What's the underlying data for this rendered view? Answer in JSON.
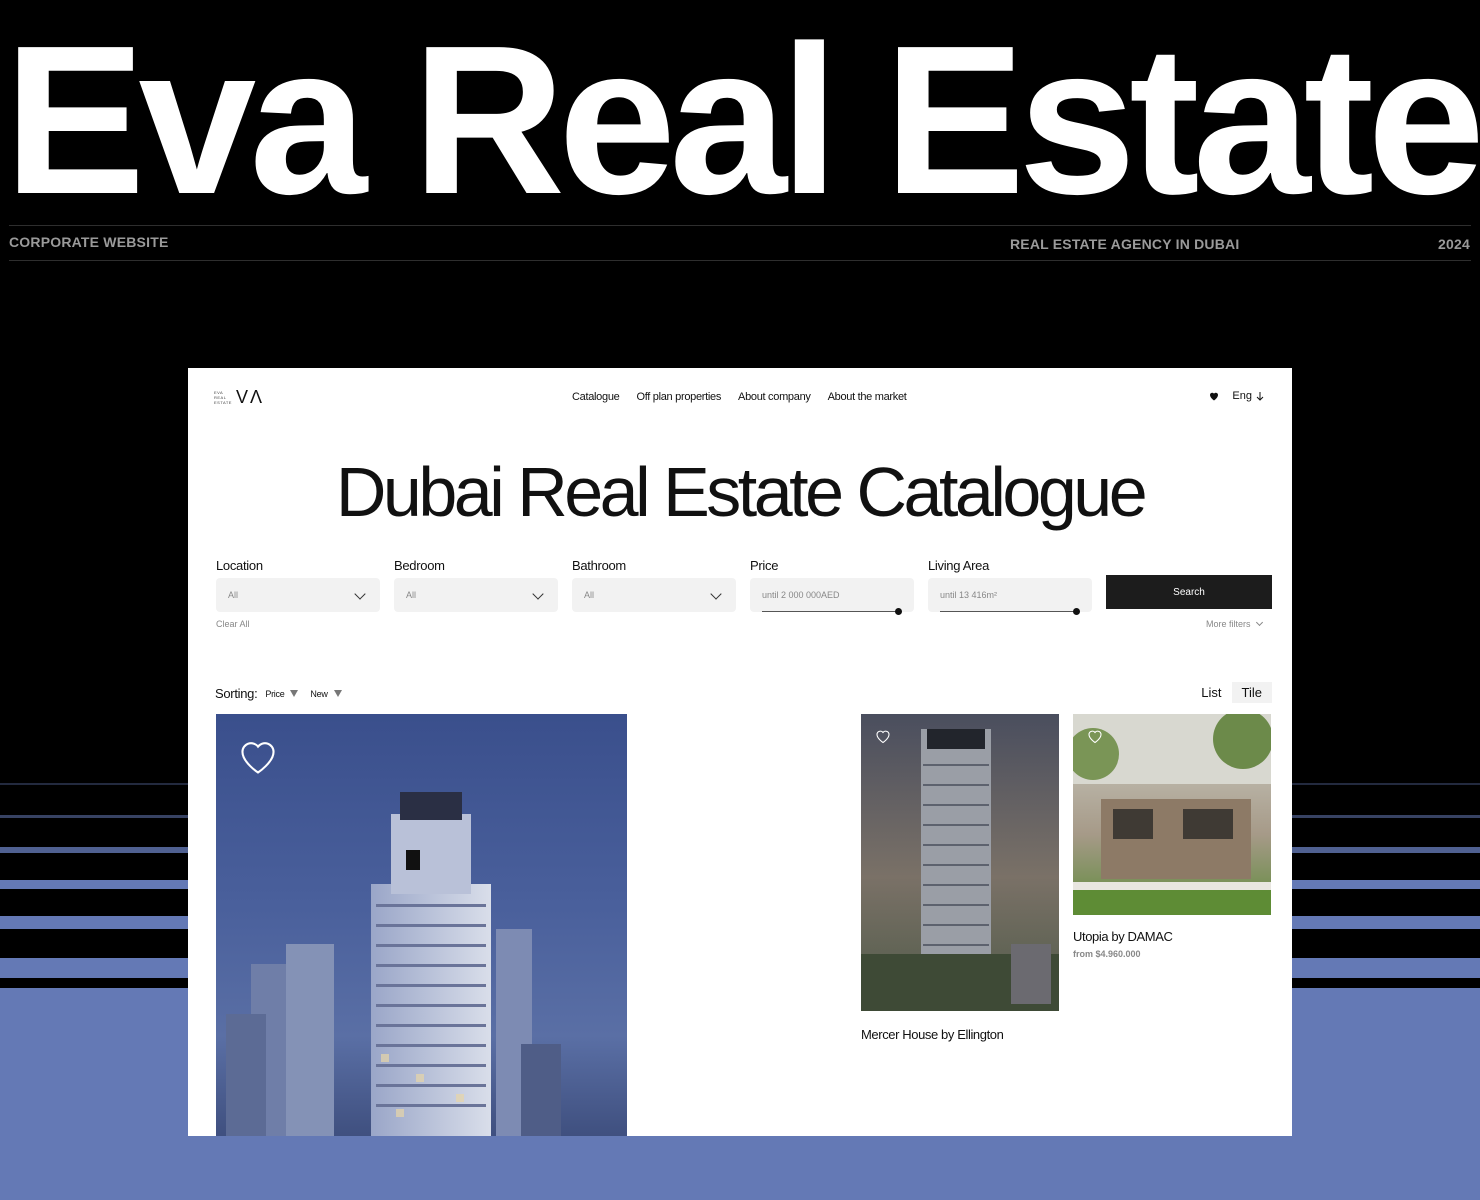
{
  "hero": {
    "title": "Eva Real Estate",
    "category": "CORPORATE WEBSITE",
    "subtitle": "REAL ESTATE AGENCY IN DUBAI",
    "year": "2024"
  },
  "colors": {
    "background": "#000000",
    "accent_blue": "#6479b5",
    "button_dark": "#1c1c1c",
    "input_bg": "#f2f2f2"
  },
  "site": {
    "logo": {
      "small_lines": [
        "EVA",
        "REAL",
        "ESTATE"
      ],
      "mark": "VΛ"
    },
    "nav": [
      "Catalogue",
      "Off plan properties",
      "About company",
      "About the market"
    ],
    "favorites_icon": "heart-icon",
    "language": "Eng",
    "page_title": "Dubai Real Estate Catalogue",
    "filters": {
      "location": {
        "label": "Location",
        "value": "All"
      },
      "bedroom": {
        "label": "Bedroom",
        "value": "All"
      },
      "bathroom": {
        "label": "Bathroom",
        "value": "All"
      },
      "price": {
        "label": "Price",
        "value": "until 2 000 000AED"
      },
      "living_area": {
        "label": "Living Area",
        "value": "until 13 416m²"
      },
      "search_label": "Search",
      "clear_all": "Clear All",
      "more_filters": "More filters"
    },
    "sorting": {
      "label": "Sorting:",
      "options": [
        "Price",
        "New"
      ]
    },
    "view": {
      "list": "List",
      "tile": "Tile",
      "active": "Tile"
    },
    "listings": [
      {
        "name": "Mercer House by Ellington"
      },
      {
        "name": "Utopia by DAMAC",
        "price": "from $4.960.000"
      }
    ]
  }
}
